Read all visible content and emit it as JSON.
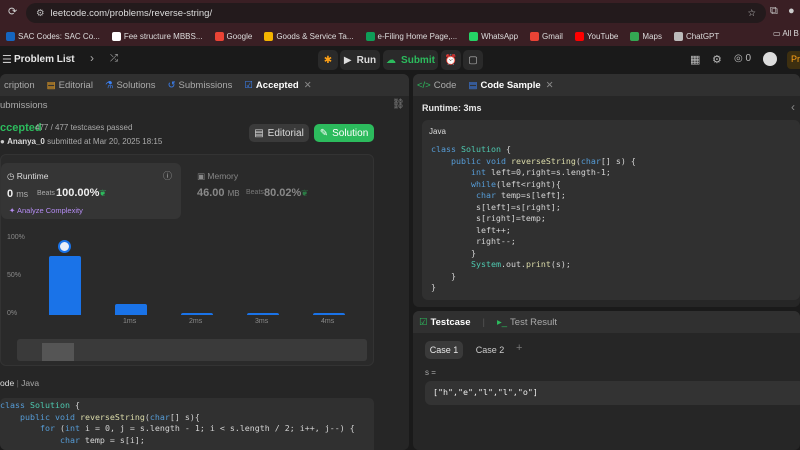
{
  "browser": {
    "url": "leetcode.com/problems/reverse-string/",
    "bookmarks": [
      {
        "label": "SAC Codes: SAC Co...",
        "color": "#1565c0"
      },
      {
        "label": "Fee structure MBBS...",
        "color": "#ffffff"
      },
      {
        "label": "Google",
        "color": "#ea4335"
      },
      {
        "label": "Goods & Service Ta...",
        "color": "#f4b400"
      },
      {
        "label": "e-Filing Home Page,...",
        "color": "#0f9d58"
      },
      {
        "label": "WhatsApp",
        "color": "#25d366"
      },
      {
        "label": "Gmail",
        "color": "#ea4335"
      },
      {
        "label": "YouTube",
        "color": "#ff0000"
      },
      {
        "label": "Maps",
        "color": "#34a853"
      },
      {
        "label": "ChatGPT",
        "color": "#bbbbbb"
      }
    ],
    "all_bookmarks": "All B"
  },
  "header": {
    "problem_list": "Problem List",
    "run": "Run",
    "submit": "Submit",
    "coins": "0",
    "premium": "Pr"
  },
  "left_tabs": [
    "cription",
    "Editorial",
    "Solutions",
    "Submissions",
    "Accepted"
  ],
  "submissions_label": "ubmissions",
  "result": {
    "status": "ccepted",
    "passed": "477 / 477 testcases passed",
    "user": "Ananya_0",
    "submitted": "submitted at Mar 20, 2025 18:15",
    "editorial_btn": "Editorial",
    "solution_btn": "Solution"
  },
  "runtime": {
    "label": "Runtime",
    "value": "0",
    "unit": "ms",
    "beats_label": "Beats",
    "beats": "100.00%",
    "analyze": "Analyze Complexity"
  },
  "memory": {
    "label": "Memory",
    "value": "46.00",
    "unit": "MB",
    "beats_label": "Beats",
    "beats": "80.02%"
  },
  "chart_data": {
    "type": "bar",
    "title": "",
    "xlabel": "",
    "ylabel": "",
    "categories": [
      "0ms",
      "1ms",
      "2ms",
      "3ms",
      "4ms"
    ],
    "values": [
      77,
      14,
      3,
      3,
      3
    ],
    "ylim": [
      0,
      100
    ],
    "y_ticks": [
      "100%",
      "50%",
      "0%"
    ],
    "x_tick_labels": [
      "",
      "1ms",
      "2ms",
      "3ms",
      "4ms"
    ],
    "color": "#1a73e8"
  },
  "code_section": {
    "label_code": "ode",
    "label_lang": "Java",
    "lines": [
      "class Solution {",
      "    public void reverseString(char[] s){",
      "        for (int i = 0, j = s.length - 1; i < s.length / 2; i++, j--) {",
      "            char temp = s[i];"
    ]
  },
  "right_top": {
    "tab_code": "Code",
    "tab_sample": "Code Sample",
    "runtime": "Runtime: 3ms",
    "lang": "Java",
    "lines": [
      "class Solution {",
      "    public void reverseString(char[] s) {",
      "        int left=0,right=s.length-1;",
      "        while(left<right){",
      "         char temp=s[left];",
      "         s[left]=s[right];",
      "         s[right]=temp;",
      "         left++;",
      "         right--;",
      "        }",
      "        System.out.print(s);",
      "    }",
      "}"
    ]
  },
  "right_bottom": {
    "tab_testcase": "Testcase",
    "tab_result": "Test Result",
    "case1": "Case 1",
    "case2": "Case 2",
    "plus": "+",
    "var_label": "s =",
    "value": "[\"h\",\"e\",\"l\",\"l\",\"o\"]"
  }
}
